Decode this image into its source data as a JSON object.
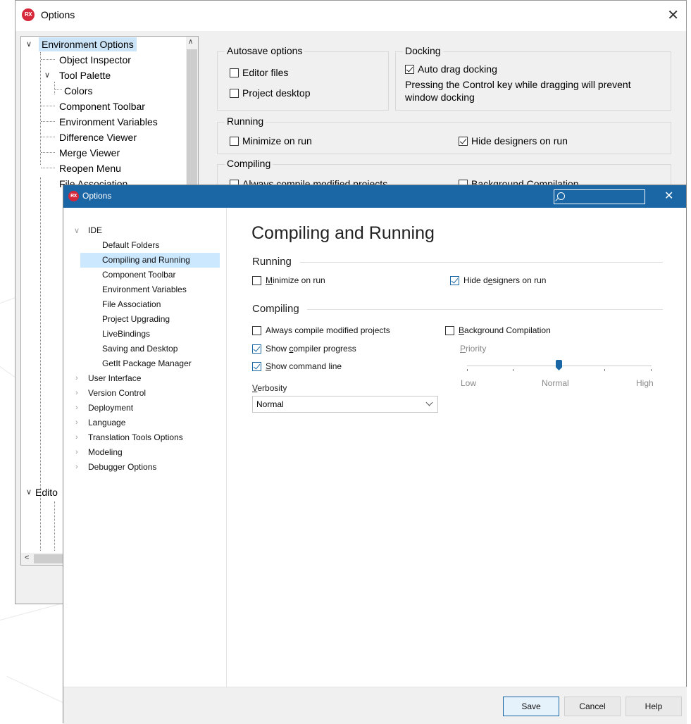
{
  "old_window": {
    "title": "Options",
    "logo_text": "RX",
    "close_glyph": "✕",
    "tree": [
      {
        "label": "Environment Options",
        "expander": "∨",
        "selected": true
      },
      {
        "label": "Object Inspector"
      },
      {
        "label": "Tool Palette",
        "expander": "∨"
      },
      {
        "label": "Colors"
      },
      {
        "label": "Component Toolbar"
      },
      {
        "label": "Environment Variables"
      },
      {
        "label": "Difference Viewer"
      },
      {
        "label": "Merge Viewer"
      },
      {
        "label": "Reopen Menu"
      },
      {
        "label": "File Association"
      },
      {
        "label": "Edito",
        "expander": "∨"
      }
    ],
    "autosave": {
      "title": "Autosave options",
      "editor_files": "Editor files",
      "project_desktop": "Project desktop"
    },
    "docking": {
      "title": "Docking",
      "auto_drag": "Auto drag docking",
      "note": "Pressing the Control key while dragging will prevent window docking"
    },
    "running": {
      "title": "Running",
      "minimize": "Minimize on run",
      "hide_designers": "Hide designers on run"
    },
    "compiling": {
      "title": "Compiling",
      "always": "Always compile modified projects",
      "background": "Background Compilation"
    }
  },
  "new_window": {
    "title": "Options",
    "logo_text": "RX",
    "close_glyph": "✕",
    "search": {
      "value": ""
    },
    "nav": [
      {
        "label": "IDE",
        "chevron": "∨",
        "expanded": true
      },
      {
        "label": "Default Folders"
      },
      {
        "label": "Compiling and Running",
        "selected": true
      },
      {
        "label": "Component Toolbar"
      },
      {
        "label": "Environment Variables"
      },
      {
        "label": "File Association"
      },
      {
        "label": "Project Upgrading"
      },
      {
        "label": "LiveBindings"
      },
      {
        "label": "Saving and Desktop"
      },
      {
        "label": "GetIt Package Manager"
      },
      {
        "label": "User Interface",
        "chevron": "›"
      },
      {
        "label": "Version Control",
        "chevron": "›"
      },
      {
        "label": "Deployment",
        "chevron": "›"
      },
      {
        "label": "Language",
        "chevron": "›"
      },
      {
        "label": "Translation Tools Options",
        "chevron": "›"
      },
      {
        "label": "Modeling",
        "chevron": "›"
      },
      {
        "label": "Debugger Options",
        "chevron": "›"
      }
    ],
    "page_title": "Compiling and Running",
    "running": {
      "title": "Running",
      "minimize_pre": "",
      "minimize_u": "M",
      "minimize_post": "inimize on run",
      "hide_pre": "Hide d",
      "hide_u": "e",
      "hide_post": "signers on run"
    },
    "compiling": {
      "title": "Compiling",
      "always": "Always compile modified projects",
      "show_progress_pre": "Show ",
      "show_progress_u": "c",
      "show_progress_post": "ompiler progress",
      "show_cmd_pre": "",
      "show_cmd_u": "S",
      "show_cmd_post": "how command line",
      "background_u": "B",
      "background_post": "ackground Compilation",
      "priority_u": "P",
      "priority_post": "riority",
      "verbosity_u": "V",
      "verbosity_post": "erbosity",
      "verbosity_value": "Normal",
      "slider_labels": {
        "low": "Low",
        "normal": "Normal",
        "high": "High"
      },
      "slider_position": 0.5
    },
    "buttons": {
      "save": "Save",
      "cancel": "Cancel",
      "help": "Help"
    }
  },
  "colors": {
    "accent": "#1b67a6",
    "selection": "#cce8ff",
    "logo": "#d6283a"
  }
}
